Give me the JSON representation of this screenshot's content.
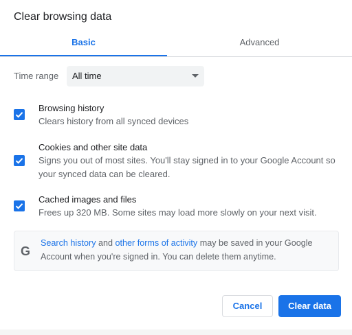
{
  "dialog": {
    "title": "Clear browsing data",
    "tabs": [
      {
        "label": "Basic",
        "selected": true
      },
      {
        "label": "Advanced",
        "selected": false
      }
    ],
    "time_range": {
      "label": "Time range",
      "value": "All time"
    },
    "options": [
      {
        "title": "Browsing history",
        "description": "Clears history from all synced devices",
        "checked": true
      },
      {
        "title": "Cookies and other site data",
        "description_line1": "Signs you out of most sites. You'll stay signed in to your Google Account so",
        "description_line2": "your synced data can be cleared.",
        "checked": true
      },
      {
        "title": "Cached images and files",
        "description": "Frees up 320 MB. Some sites may load more slowly on your next visit.",
        "checked": true
      }
    ],
    "info": {
      "icon": "google-g-icon",
      "link1": "Search history",
      "text1": " and ",
      "link2": "other forms of activity",
      "text2": " may be saved in your Google",
      "line2": "Account when you're signed in. You can delete them anytime."
    },
    "buttons": {
      "cancel": "Cancel",
      "clear": "Clear data"
    },
    "colors": {
      "accent": "#1a73e8",
      "secondary_text": "#5f6368",
      "field_bg": "#f1f3f4"
    }
  }
}
